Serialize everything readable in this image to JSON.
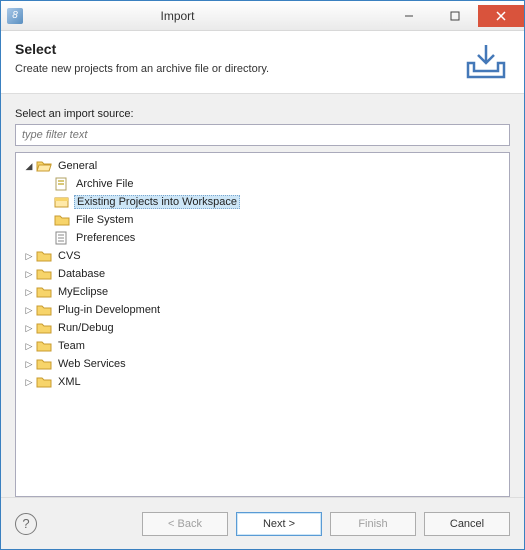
{
  "window": {
    "title": "Import"
  },
  "header": {
    "heading": "Select",
    "description": "Create new projects from an archive file or directory."
  },
  "body": {
    "source_label": "Select an import source:",
    "filter_placeholder": "type filter text"
  },
  "tree": {
    "root": {
      "label": "General",
      "expanded": true,
      "children": [
        {
          "label": "Archive File",
          "icon": "archive"
        },
        {
          "label": "Existing Projects into Workspace",
          "icon": "project",
          "selected": true
        },
        {
          "label": "File System",
          "icon": "folder-plain"
        },
        {
          "label": "Preferences",
          "icon": "prefs"
        }
      ]
    },
    "siblings": [
      {
        "label": "CVS"
      },
      {
        "label": "Database"
      },
      {
        "label": "MyEclipse"
      },
      {
        "label": "Plug-in Development"
      },
      {
        "label": "Run/Debug"
      },
      {
        "label": "Team"
      },
      {
        "label": "Web Services"
      },
      {
        "label": "XML"
      }
    ]
  },
  "buttons": {
    "back": "< Back",
    "next": "Next >",
    "finish": "Finish",
    "cancel": "Cancel"
  }
}
